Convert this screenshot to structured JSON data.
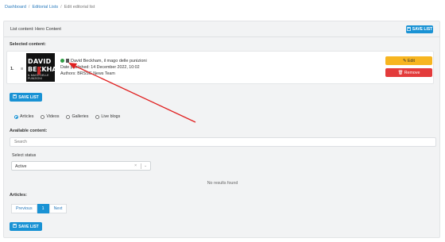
{
  "breadcrumb": {
    "items": [
      "Dashboard",
      "Editorial Lists"
    ],
    "separator": "/",
    "current": "Edit editorial list"
  },
  "panel": {
    "title": "List content: Hero Content",
    "save_label": "SAVE LIST"
  },
  "selected": {
    "heading": "Selected content:",
    "item": {
      "number": "1.",
      "drag_icon": "≡",
      "thumbnail_text": [
        "DAVID",
        "BECKHAM",
        "IL MAGO DELLE PUNIZIONI"
      ],
      "title": "David Beckham, il mago delle punizioni",
      "date": "Date published: 14 December 2022, 10:02",
      "authors": "Authors: BRSSG News Team",
      "edit_label": "Edit",
      "remove_label": "Remove"
    }
  },
  "save_label": "SAVE LIST",
  "content_types": [
    {
      "label": "Articles",
      "checked": true
    },
    {
      "label": "Videos",
      "checked": false
    },
    {
      "label": "Galleries",
      "checked": false
    },
    {
      "label": "Live blogs",
      "checked": false
    }
  ],
  "available": {
    "heading": "Available content:",
    "search_placeholder": "Search",
    "status_label": "Select status",
    "status_value": "Active",
    "no_results": "No results found"
  },
  "articles": {
    "heading": "Articles:",
    "pagination": {
      "previous": "Previous",
      "page": "1",
      "next": "Next"
    }
  },
  "colors": {
    "primary": "#1992d4",
    "warning": "#f7b520",
    "danger": "#e33b3b",
    "annotation": "#e02020"
  },
  "icons": {
    "save": "floppy-icon",
    "edit": "pencil-icon",
    "remove": "trash-icon",
    "status": "check-circle-icon",
    "doc": "document-icon"
  }
}
